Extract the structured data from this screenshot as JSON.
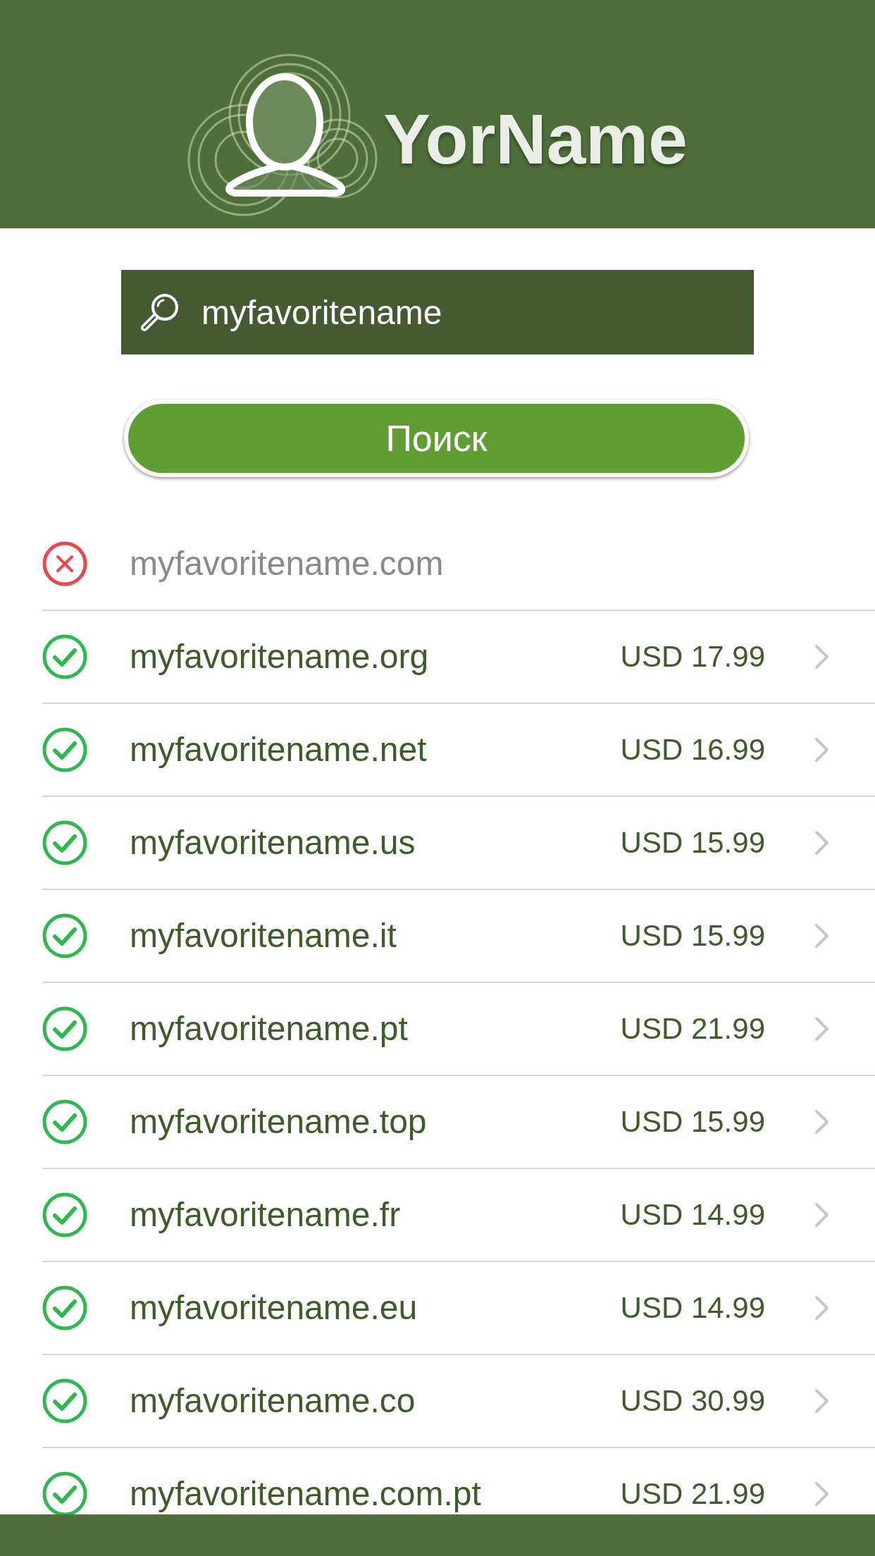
{
  "header": {
    "logo_text": "YorName"
  },
  "search": {
    "value": "myfavoritename",
    "button": "Поиск"
  },
  "results": [
    {
      "domain": "myfavoritename.com",
      "available": false
    },
    {
      "domain": "myfavoritename.org",
      "available": true,
      "price": "USD 17.99"
    },
    {
      "domain": "myfavoritename.net",
      "available": true,
      "price": "USD 16.99"
    },
    {
      "domain": "myfavoritename.us",
      "available": true,
      "price": "USD 15.99"
    },
    {
      "domain": "myfavoritename.it",
      "available": true,
      "price": "USD 15.99"
    },
    {
      "domain": "myfavoritename.pt",
      "available": true,
      "price": "USD 21.99"
    },
    {
      "domain": "myfavoritename.top",
      "available": true,
      "price": "USD 15.99"
    },
    {
      "domain": "myfavoritename.fr",
      "available": true,
      "price": "USD 14.99"
    },
    {
      "domain": "myfavoritename.eu",
      "available": true,
      "price": "USD 14.99"
    },
    {
      "domain": "myfavoritename.co",
      "available": true,
      "price": "USD 30.99"
    },
    {
      "domain": "myfavoritename.com.pt",
      "available": true,
      "price": "USD 21.99"
    }
  ]
}
